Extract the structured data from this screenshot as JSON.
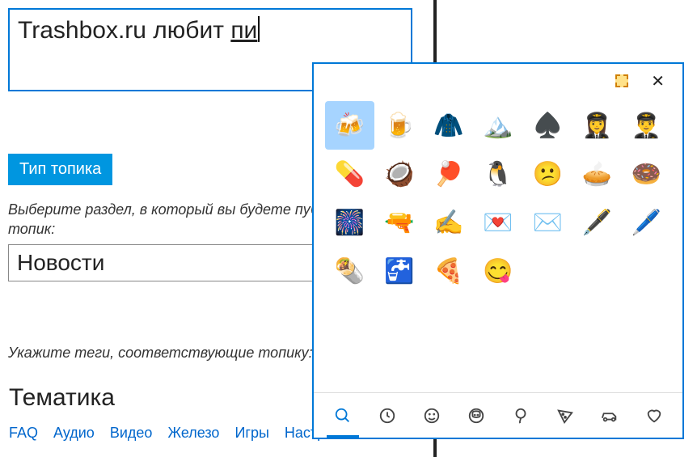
{
  "title_input": {
    "text_prefix": "Trashbox.ru любит ",
    "ime_suggestion": "пи"
  },
  "topic_type_button": "Тип топика",
  "section_helper": "Выберите раздел, в который вы будете публиковать топик:",
  "section_select": {
    "value": "Новости"
  },
  "tags_helper": "Укажите теги, соответствующие топику:",
  "theme_heading": "Тематика",
  "tag_links": [
    "FAQ",
    "Аудио",
    "Видео",
    "Железо",
    "Игры",
    "Настройка"
  ],
  "emoji_picker": {
    "tabs": [
      {
        "name": "search",
        "active": true
      },
      {
        "name": "recent",
        "active": false
      },
      {
        "name": "smileys",
        "active": false
      },
      {
        "name": "people",
        "active": false
      },
      {
        "name": "celebration",
        "active": false
      },
      {
        "name": "food",
        "active": false
      },
      {
        "name": "transport",
        "active": false
      },
      {
        "name": "hearts",
        "active": false
      }
    ],
    "grid": [
      {
        "name": "beer-mugs",
        "glyph": "🍻",
        "selected": true
      },
      {
        "name": "beer-mug",
        "glyph": "🍺",
        "selected": false
      },
      {
        "name": "coat",
        "glyph": "🧥",
        "selected": false
      },
      {
        "name": "mountain",
        "glyph": "🏔️",
        "selected": false
      },
      {
        "name": "spade-suit",
        "glyph": "♠️",
        "selected": false
      },
      {
        "name": "woman-pilot",
        "glyph": "👩‍✈️",
        "selected": false
      },
      {
        "name": "man-pilot",
        "glyph": "👨‍✈️",
        "selected": false
      },
      {
        "name": "pill",
        "glyph": "💊",
        "selected": false
      },
      {
        "name": "coconut",
        "glyph": "🥥",
        "selected": false
      },
      {
        "name": "ping-pong",
        "glyph": "🏓",
        "selected": false
      },
      {
        "name": "penguin",
        "glyph": "🐧",
        "selected": false
      },
      {
        "name": "confused-face",
        "glyph": "😕",
        "selected": false
      },
      {
        "name": "pie",
        "glyph": "🥧",
        "selected": false
      },
      {
        "name": "doughnut",
        "glyph": "🍩",
        "selected": false
      },
      {
        "name": "fireworks",
        "glyph": "🎆",
        "selected": false
      },
      {
        "name": "pistol",
        "glyph": "🔫",
        "selected": false
      },
      {
        "name": "writing-hand",
        "glyph": "✍️",
        "selected": false
      },
      {
        "name": "love-letter",
        "glyph": "💌",
        "selected": false
      },
      {
        "name": "envelope",
        "glyph": "✉️",
        "selected": false
      },
      {
        "name": "fountain-pen",
        "glyph": "🖋️",
        "selected": false
      },
      {
        "name": "pen",
        "glyph": "🖊️",
        "selected": false
      },
      {
        "name": "burrito",
        "glyph": "🌯",
        "selected": false
      },
      {
        "name": "potable-water",
        "glyph": "🚰",
        "selected": false
      },
      {
        "name": "pizza",
        "glyph": "🍕",
        "selected": false
      },
      {
        "name": "yum-face",
        "glyph": "😋",
        "selected": false
      }
    ]
  }
}
